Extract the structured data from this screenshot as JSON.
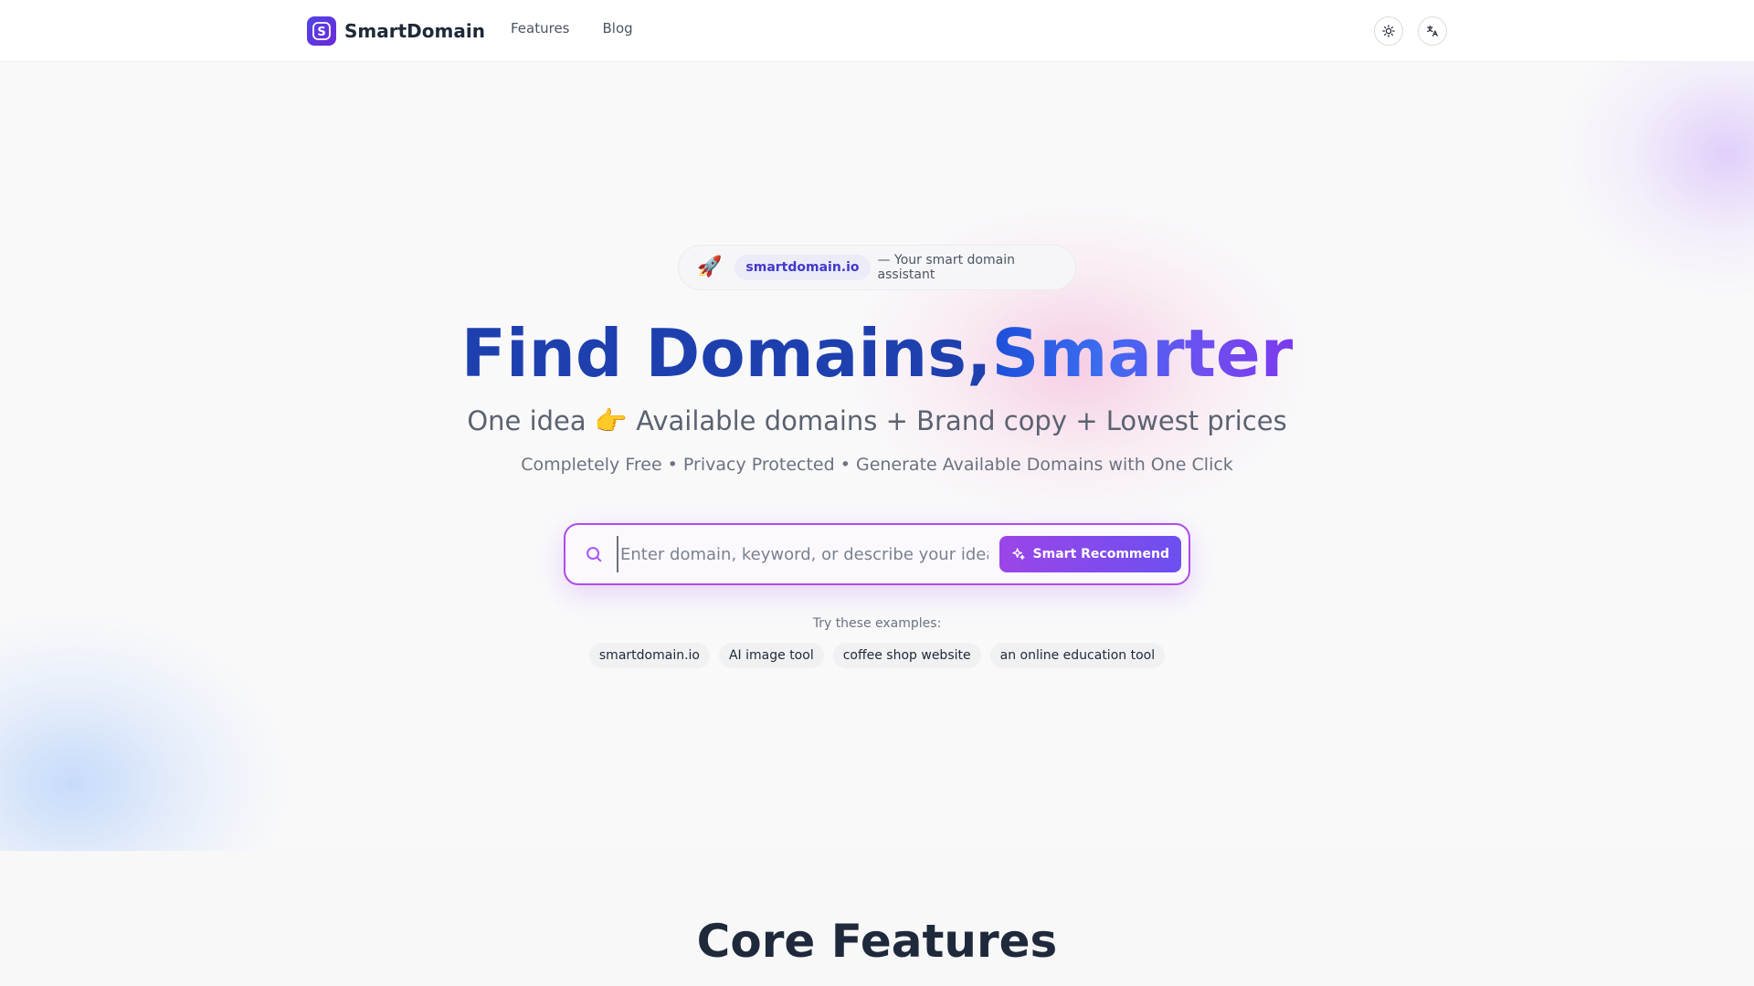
{
  "header": {
    "brand": "SmartDomain",
    "logo_glyph": "S",
    "nav": [
      {
        "label": "Features"
      },
      {
        "label": "Blog"
      }
    ],
    "icons": {
      "theme": "sun-icon",
      "language": "translate-icon"
    }
  },
  "hero": {
    "badge": {
      "emoji": "🚀",
      "pill": "smartdomain.io",
      "text": "— Your smart domain assistant"
    },
    "title_part1": "Find Domains,",
    "title_part2": "Smarter",
    "subtitle": "One idea 👉 Available domains + Brand copy + Lowest prices",
    "tagline": "Completely Free • Privacy Protected • Generate Available Domains with One Click",
    "search": {
      "placeholder": "Enter domain, keyword, or describe your idea",
      "value": "",
      "button_label": "Smart Recommend"
    },
    "examples_label": "Try these examples:",
    "examples": [
      {
        "label": "smartdomain.io"
      },
      {
        "label": "AI image tool"
      },
      {
        "label": "coffee shop website"
      },
      {
        "label": "an online education tool"
      }
    ]
  },
  "features": {
    "title": "Core Features"
  },
  "colors": {
    "accent_purple": "#a855f7",
    "accent_indigo": "#4f46e5",
    "title_blue": "#1e40af"
  }
}
